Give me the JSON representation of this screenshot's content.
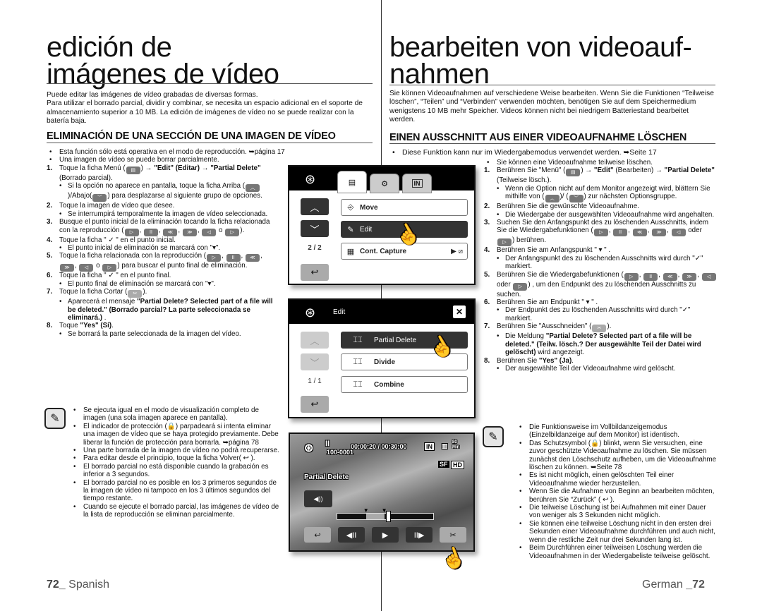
{
  "spanish": {
    "title_line1": "edición de",
    "title_line2": "imágenes de vídeo",
    "intro": [
      "Puede editar las imágenes de vídeo grabadas de diversas formas.",
      "Para utilizar el borrado parcial, dividir y combinar, se necesita un espacio adicional en el soporte de almacenamiento superior a 10 MB. La edición de imágenes de vídeo no se puede realizar con la batería baja."
    ],
    "section_heading": "ELIMINACIÓN DE UNA SECCIÓN DE UNA IMAGEN DE VÍDEO",
    "bullets": [
      "Esta función sólo está operativa en el modo de reproducción. ➥página 17",
      "Una imagen de vídeo se puede borrar parcialmente."
    ],
    "steps": [
      {
        "num": "1.",
        "pre": "Toque la ficha Menú (",
        "post": ") → ",
        "b1": "\"Edit\" (Editar) → \"Partial Delete\"",
        "tail": " (Borrado parcial).",
        "sub": "Si la opción no aparece en pantalla, toque la ficha Arriba (",
        "sub_mid": ")/Abajo(",
        "sub_end": ")  para desplazarse al siguiente grupo de opciones."
      },
      {
        "num": "2.",
        "text": "Toque la imagen de vídeo que desee.",
        "sub": "Se interrumpirá temporalmente la imagen de vídeo seleccionada."
      },
      {
        "num": "3.",
        "text": "Busque el punto inicial de la eliminación tocando la ficha relacionada con la reproducción (",
        "mid": " o ",
        "tail": ")."
      },
      {
        "num": "4.",
        "text": "Toque la ficha \" ✓ \"  en el punto inicial.",
        "sub": "El punto inicial de eliminación se marcará con \"▾\"."
      },
      {
        "num": "5.",
        "text": "Toque la ficha relacionada con la reproducción (",
        "mid": " o ",
        "tail": ")  para buscar el punto final de eliminación."
      },
      {
        "num": "6.",
        "text": "Toque la ficha \" ✓ \"  en el punto final.",
        "sub": "El punto final de eliminación se marcará con \"▾\"."
      },
      {
        "num": "7.",
        "text": "Toque la ficha Cortar (",
        "tail": ").",
        "sub_pre": "Aparecerá el mensaje ",
        "sub_bold": "\"Partial Delete? Selected part of a file will be deleted.\" (Borrado parcial? La parte seleccionada se eliminará.)",
        "sub_end": " ."
      },
      {
        "num": "8.",
        "text_pre": "Toque ",
        "text_bold": "\"Yes\" (Sí)",
        "text_end": ".",
        "sub": "Se borrará la parte seleccionada de la imagen del vídeo."
      }
    ],
    "notes": [
      "Se ejecuta igual en el modo de visualización completo de imagen (una sola imagen aparece en pantalla).",
      "El indicador de protección (🔒) parpadeará si intenta eliminar una imagen de vídeo que se haya protegido previamente. Debe liberar la función de protección para borrarla. ➥página 78",
      "Una parte borrada de la imagen de vídeo no podrá recuperarse.",
      "Para editar desde el principio, toque la ficha Volver( ↩ ).",
      "El borrado parcial no está disponible cuando la grabación es inferior a 3 segundos.",
      "El borrado parcial no es posible en los 3 primeros segundos de la imagen de vídeo ni tampoco en los 3 últimos segundos del tiempo restante.",
      "Cuando se ejecute el borrado parcial, las imágenes de vídeo de la lista de reproducción se eliminan parcialmente."
    ],
    "footer_num": "72_",
    "footer_lang": " Spanish"
  },
  "german": {
    "title_line1": "bearbeiten von videoauf-",
    "title_line2": "nahmen",
    "intro": "Sie können Videoaufnahmen auf verschiedene Weise bearbeiten. Wenn Sie die Funktionen “Teilweise löschen”, “Teilen” und “Verbinden” verwenden möchten, benötigen Sie auf dem Speichermedium wenigstens 10 MB mehr Speicher. Videos können nicht bei niedrigem Batteriestand bearbeitet werden.",
    "section_heading": "EINEN AUSSCHNITT AUS EINER VIDEOAUFNAHME LÖSCHEN",
    "bullets": [
      "Diese Funktion kann nur im Wiedergabemodus verwendet werden. ➥Seite 17",
      "Sie können eine Videoaufnahme teilweise löschen."
    ],
    "steps": [
      {
        "num": "1.",
        "pre": "Berühren Sie \"Menü\" (",
        "post": ") → ",
        "b1": "\"Edit\"",
        "mid": " (Bearbeiten) → ",
        "b2": "\"Partial Delete\"",
        "tail": " (Teilweise lösch.).",
        "sub": "Wenn die Option nicht auf dem Monitor angezeigt wird, blättern Sie mithilfe von (",
        "sub_mid": ")/ (",
        "sub_end": ") zur nächsten Optionsgruppe."
      },
      {
        "num": "2.",
        "text": "Berühren Sie die gewünschte Videoaufnahme.",
        "sub": "Die Wiedergabe der ausgewählten Videoaufnahme wird angehalten."
      },
      {
        "num": "3.",
        "text": "Suchen Sie den Anfangspunkt des zu löschenden Ausschnitts, indem Sie die  Wiedergabefunktionen (",
        "mid": " oder ",
        "tail": ") berühren."
      },
      {
        "num": "4.",
        "text": "Berühren Sie am Anfangspunkt \" ▾ \" .",
        "sub": "Der Anfangspunkt des zu löschenden Ausschnitts wird durch \"✓\" markiert."
      },
      {
        "num": "5.",
        "text": "Berühren Sie die Wiedergabefunktionen (",
        "mid": " oder ",
        "tail": ") , um den Endpunkt des zu löschenden Ausschnitts zu suchen."
      },
      {
        "num": "6.",
        "text": "Berühren Sie am Endpunkt \" ▾ \" .",
        "sub": "Der Endpunkt des zu löschenden Ausschnitts wird durch \"✓\" markiert."
      },
      {
        "num": "7.",
        "text": "Berühren Sie \"Ausschneiden\" (",
        "tail": ").",
        "sub_pre": "Die Meldung ",
        "sub_bold": "\"Partial Delete? Selected part of a file will be deleted.\" (Teilw. lösch.? Der ausgewählte Teil der Datei wird gelöscht)",
        "sub_end": " wird angezeigt."
      },
      {
        "num": "8.",
        "text_pre": "Berühren Sie ",
        "text_bold": "\"Yes\" (Ja)",
        "text_end": ".",
        "sub": "Der ausgewählte Teil der Videoaufnahme wird gelöscht."
      }
    ],
    "notes": [
      "Die Funktionsweise im Vollbildanzeigemodus (Einzelbildanzeige auf dem Monitor) ist identisch.",
      "Das Schutzsymbol (🔒) blinkt, wenn Sie versuchen, eine zuvor geschützte Videoaufnahme zu löschen. Sie müssen zunächst den Löschschutz aufheben, um die Videoaufnahme löschen zu können. ➥Seite 78",
      "Es ist nicht möglich, einen gelöschten Teil einer Videoaufnahme wieder herzustellen.",
      "Wenn Sie die Aufnahme von Beginn an bearbeiten möchten, berühren Sie “Zurück” ( ↩ ).",
      "Die teilweise Löschung ist bei Aufnahmen mit einer Dauer von weniger als 3 Sekunden nicht möglich.",
      "Sie können eine teilweise Löschung nicht in den ersten drei Sekunden einer Videoaufnahme durchführen und auch nicht, wenn die restliche Zeit nur drei Sekunden lang ist.",
      "Beim Durchführen einer teilweisen Löschung werden die Videoaufnahmen in der Wiedergabeliste teilweise gelöscht."
    ],
    "footer_lang": "German ",
    "footer_num": "_72"
  },
  "screen1": {
    "tabs": [
      "▤",
      "⚙",
      "IN"
    ],
    "menu_items": [
      {
        "icon": "⎆",
        "label": "Move"
      },
      {
        "icon": "✎",
        "label": "Edit"
      },
      {
        "icon": "▦",
        "label": "Cont. Capture",
        "value_icon": "▶ ⧄"
      }
    ],
    "page_indicator": "2 / 2",
    "up": "︿",
    "down": "﹀",
    "back": "↩"
  },
  "screen2": {
    "title": "Edit",
    "close": "✕",
    "menu_items": [
      {
        "icon": "⌶⌶",
        "label": "Partial Delete"
      },
      {
        "icon": "⌶⌶",
        "label": "Divide"
      },
      {
        "icon": "⌶⌶",
        "label": "Combine"
      }
    ],
    "page_indicator": "1 / 1",
    "up": "︿",
    "down": "﹀",
    "back": "↩"
  },
  "screen3": {
    "pause": "II",
    "timecode": "00:00:20 / 00:30:00",
    "file_id": "100-0001",
    "storage": "IN",
    "battery_label": "80 Min",
    "quality": "SF",
    "resolution": "HD",
    "mode_label": "Partial Delete",
    "volume": "◀))",
    "progress_fraction": 0.53,
    "selection_start_fraction": 0.3,
    "selection_end_fraction": 0.49,
    "controls": [
      "↩",
      "◀II",
      "▶",
      "II▶",
      "✂"
    ]
  }
}
